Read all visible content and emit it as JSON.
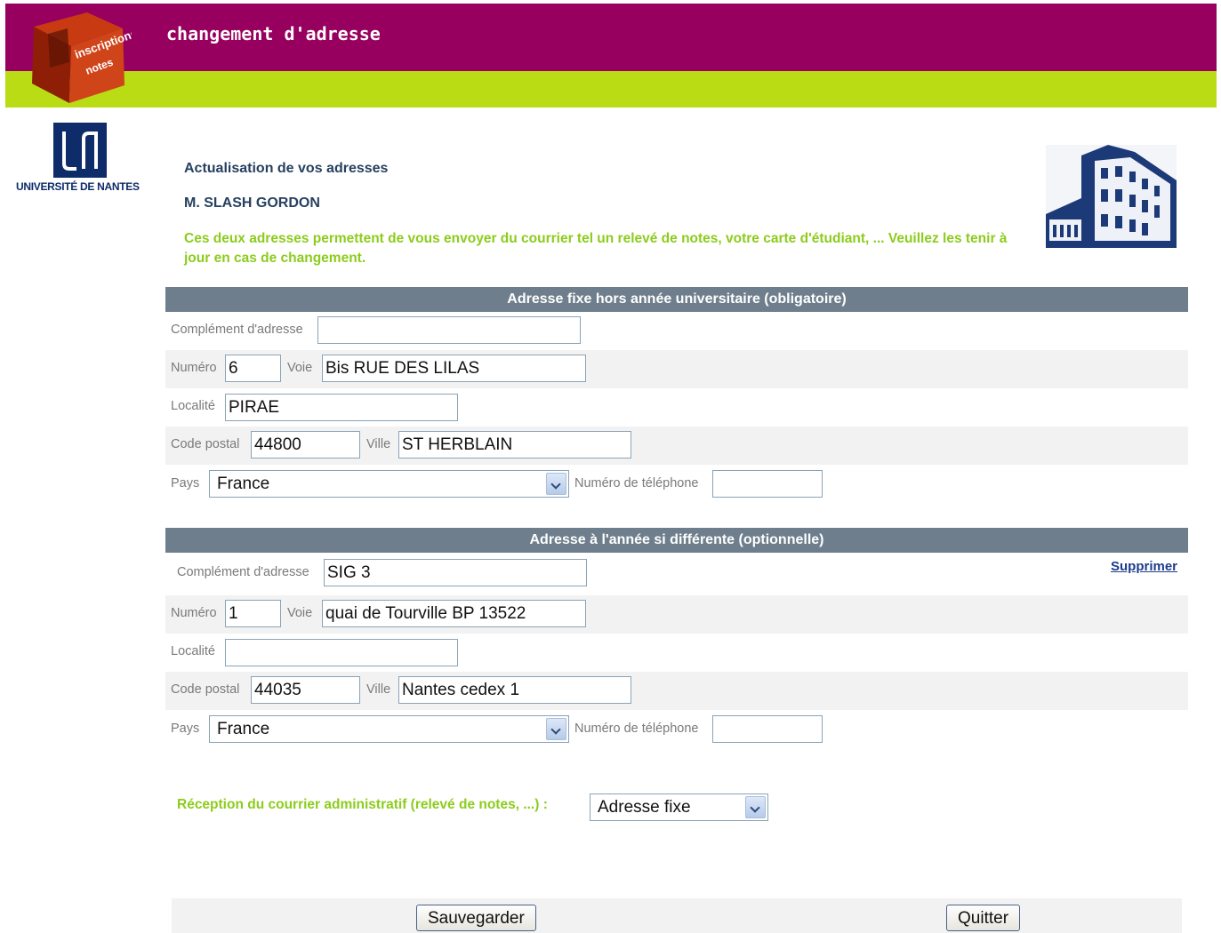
{
  "header": {
    "title": "changement d'adresse",
    "logo_text_1": "inscriptions",
    "logo_text_2": "notes"
  },
  "university": {
    "name": "UNIVERSITÉ DE NANTES"
  },
  "intro": {
    "title": "Actualisation de vos adresses",
    "student": "M. SLASH GORDON",
    "description": "Ces deux adresses permettent de vous envoyer du courrier tel un relevé de notes, votre carte d'étudiant, ... Veuillez les tenir à jour en cas de changement."
  },
  "labels": {
    "complement": "Complément d'adresse",
    "numero": "Numéro",
    "voie": "Voie",
    "localite": "Localité",
    "code_postal": "Code postal",
    "ville": "Ville",
    "pays": "Pays",
    "telephone": "Numéro de téléphone"
  },
  "fixed_address": {
    "heading": "Adresse fixe hors année universitaire (obligatoire)",
    "complement": "",
    "numero": "6",
    "voie": "Bis RUE DES LILAS",
    "localite": "PIRAE",
    "code_postal": "44800",
    "ville": "ST HERBLAIN",
    "pays": "France",
    "telephone": ""
  },
  "year_address": {
    "heading": "Adresse à l'année si différente (optionnelle)",
    "delete_link": "Supprimer",
    "complement": "SIG 3",
    "numero": "1",
    "voie": "quai de Tourville BP 13522",
    "localite": "",
    "code_postal": "44035",
    "ville": "Nantes cedex 1",
    "pays": "France",
    "telephone": ""
  },
  "mail": {
    "label": "Réception du courrier administratif (relevé de notes, ...) :",
    "selected": "Adresse fixe"
  },
  "buttons": {
    "save": "Sauvegarder",
    "quit": "Quitter"
  },
  "colors": {
    "header_purple": "#98005f",
    "header_green": "#b9dc15",
    "section_bar": "#6e7e8c",
    "accent_green_text": "#8ccc1c",
    "title_blue": "#264060"
  }
}
